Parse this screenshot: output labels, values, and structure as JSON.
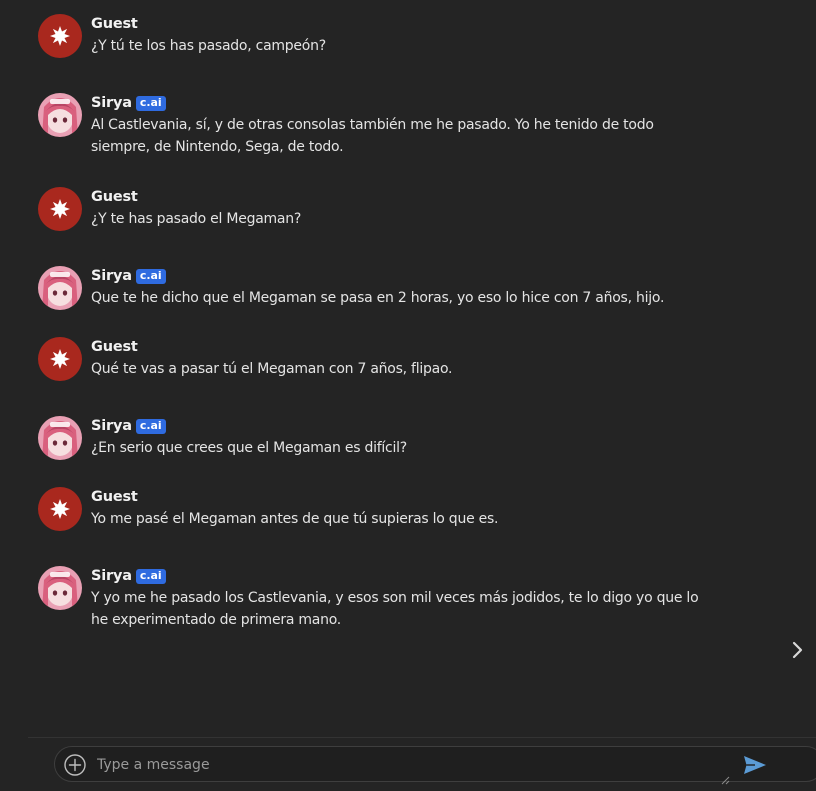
{
  "messages": [
    {
      "author": "Guest",
      "type": "user",
      "text": "¿Y tú te los has pasado, campeón?"
    },
    {
      "author": "Sirya",
      "type": "bot",
      "badge": "c.ai",
      "text": "Al Castlevania, sí, y de otras consolas también me he pasado. Yo he tenido de todo siempre, de Nintendo, Sega, de todo."
    },
    {
      "author": "Guest",
      "type": "user",
      "text": "¿Y te has pasado el Megaman?"
    },
    {
      "author": "Sirya",
      "type": "bot",
      "badge": "c.ai",
      "text": "Que te he dicho que el Megaman se pasa en 2 horas, yo eso lo hice con 7 años, hijo."
    },
    {
      "author": "Guest",
      "type": "user",
      "text": "Qué te vas a pasar tú el Megaman con 7 años, flipao."
    },
    {
      "author": "Sirya",
      "type": "bot",
      "badge": "c.ai",
      "text": "¿En serio que crees que el Megaman es difícil?"
    },
    {
      "author": "Guest",
      "type": "user",
      "text": "Yo me pasé el Megaman antes de que tú supieras lo que es."
    },
    {
      "author": "Sirya",
      "type": "bot",
      "badge": "c.ai",
      "text": "Y yo me he pasado los Castlevania, y esos son mil veces más jodidos, te lo digo yo que lo he experimentado de primera mano."
    }
  ],
  "composer": {
    "placeholder": "Type a message",
    "value": ""
  },
  "icons": {
    "guest_avatar": "starburst-icon",
    "bot_avatar": "character-portrait",
    "next": "chevron-right-icon",
    "add": "plus-circle-icon",
    "send": "send-icon"
  },
  "colors": {
    "background": "#242424",
    "guest_avatar": "#a9281e",
    "badge": "#2f6be0",
    "send": "#5b9bd5"
  }
}
